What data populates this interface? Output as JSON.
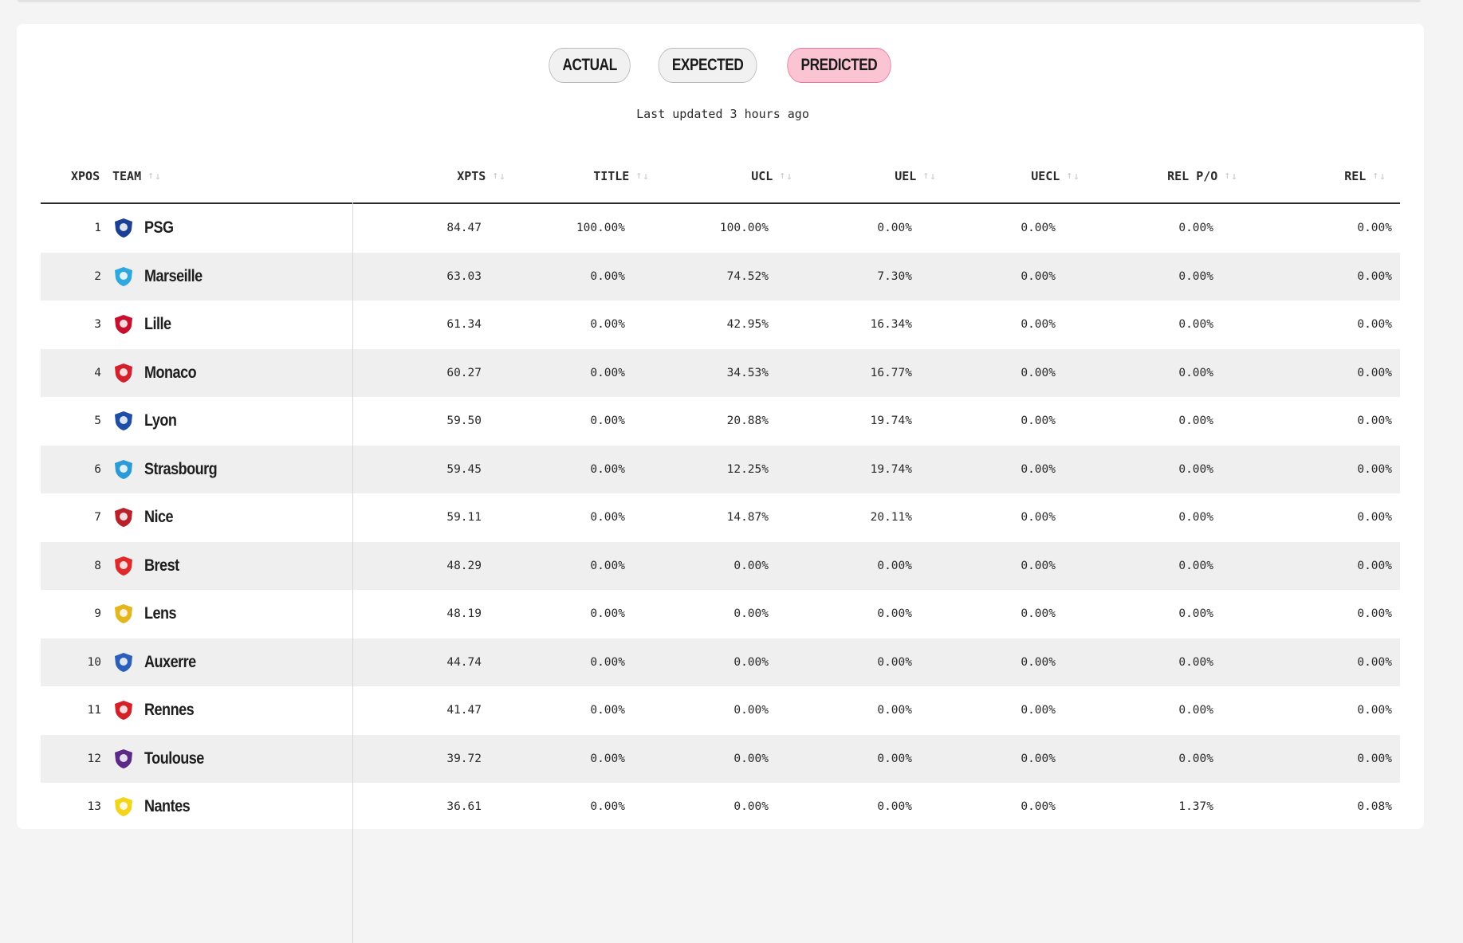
{
  "tabs": [
    {
      "label": "ACTUAL",
      "active": false
    },
    {
      "label": "EXPECTED",
      "active": false
    },
    {
      "label": "PREDICTED",
      "active": true
    }
  ],
  "last_updated": "Last updated 3 hours ago",
  "columns": {
    "xpos": "XPOS",
    "team": "TEAM",
    "xpts": "XPTS",
    "title": "TITLE",
    "ucl": "UCL",
    "uel": "UEL",
    "uecl": "UECL",
    "rel_po": "REL P/O",
    "rel": "REL"
  },
  "icons": {
    "sort": "sort-arrows-icon"
  },
  "colors": {
    "active_tab_bg": "#fbc4d3",
    "active_tab_border": "#e8789c",
    "row_alt_bg": "#efefef"
  },
  "rows": [
    {
      "xpos": "1",
      "team": "PSG",
      "crest": "psg-crest-icon",
      "crest_color": "#1c3f94",
      "xpts": "84.47",
      "title": "100.00%",
      "ucl": "100.00%",
      "uel": "0.00%",
      "uecl": "0.00%",
      "rel_po": "0.00%",
      "rel": "0.00%"
    },
    {
      "xpos": "2",
      "team": "Marseille",
      "crest": "marseille-crest-icon",
      "crest_color": "#2fa8df",
      "xpts": "63.03",
      "title": "0.00%",
      "ucl": "74.52%",
      "uel": "7.30%",
      "uecl": "0.00%",
      "rel_po": "0.00%",
      "rel": "0.00%"
    },
    {
      "xpos": "3",
      "team": "Lille",
      "crest": "lille-crest-icon",
      "crest_color": "#c8102e",
      "xpts": "61.34",
      "title": "0.00%",
      "ucl": "42.95%",
      "uel": "16.34%",
      "uecl": "0.00%",
      "rel_po": "0.00%",
      "rel": "0.00%"
    },
    {
      "xpos": "4",
      "team": "Monaco",
      "crest": "monaco-crest-icon",
      "crest_color": "#d4202c",
      "xpts": "60.27",
      "title": "0.00%",
      "ucl": "34.53%",
      "uel": "16.77%",
      "uecl": "0.00%",
      "rel_po": "0.00%",
      "rel": "0.00%"
    },
    {
      "xpos": "5",
      "team": "Lyon",
      "crest": "lyon-crest-icon",
      "crest_color": "#1e4ea8",
      "xpts": "59.50",
      "title": "0.00%",
      "ucl": "20.88%",
      "uel": "19.74%",
      "uecl": "0.00%",
      "rel_po": "0.00%",
      "rel": "0.00%"
    },
    {
      "xpos": "6",
      "team": "Strasbourg",
      "crest": "strasbourg-crest-icon",
      "crest_color": "#2a9bd6",
      "xpts": "59.45",
      "title": "0.00%",
      "ucl": "12.25%",
      "uel": "19.74%",
      "uecl": "0.00%",
      "rel_po": "0.00%",
      "rel": "0.00%"
    },
    {
      "xpos": "7",
      "team": "Nice",
      "crest": "nice-crest-icon",
      "crest_color": "#b8202a",
      "xpts": "59.11",
      "title": "0.00%",
      "ucl": "14.87%",
      "uel": "20.11%",
      "uecl": "0.00%",
      "rel_po": "0.00%",
      "rel": "0.00%"
    },
    {
      "xpos": "8",
      "team": "Brest",
      "crest": "brest-crest-icon",
      "crest_color": "#e02a2a",
      "xpts": "48.29",
      "title": "0.00%",
      "ucl": "0.00%",
      "uel": "0.00%",
      "uecl": "0.00%",
      "rel_po": "0.00%",
      "rel": "0.00%"
    },
    {
      "xpos": "9",
      "team": "Lens",
      "crest": "lens-crest-icon",
      "crest_color": "#e4b51c",
      "xpts": "48.19",
      "title": "0.00%",
      "ucl": "0.00%",
      "uel": "0.00%",
      "uecl": "0.00%",
      "rel_po": "0.00%",
      "rel": "0.00%"
    },
    {
      "xpos": "10",
      "team": "Auxerre",
      "crest": "auxerre-crest-icon",
      "crest_color": "#2c5fb8",
      "xpts": "44.74",
      "title": "0.00%",
      "ucl": "0.00%",
      "uel": "0.00%",
      "uecl": "0.00%",
      "rel_po": "0.00%",
      "rel": "0.00%"
    },
    {
      "xpos": "11",
      "team": "Rennes",
      "crest": "rennes-crest-icon",
      "crest_color": "#d42027",
      "xpts": "41.47",
      "title": "0.00%",
      "ucl": "0.00%",
      "uel": "0.00%",
      "uecl": "0.00%",
      "rel_po": "0.00%",
      "rel": "0.00%"
    },
    {
      "xpos": "12",
      "team": "Toulouse",
      "crest": "toulouse-crest-icon",
      "crest_color": "#5b2a86",
      "xpts": "39.72",
      "title": "0.00%",
      "ucl": "0.00%",
      "uel": "0.00%",
      "uecl": "0.00%",
      "rel_po": "0.00%",
      "rel": "0.00%"
    },
    {
      "xpos": "13",
      "team": "Nantes",
      "crest": "nantes-crest-icon",
      "crest_color": "#f2d51a",
      "xpts": "36.61",
      "title": "0.00%",
      "ucl": "0.00%",
      "uel": "0.00%",
      "uecl": "0.00%",
      "rel_po": "1.37%",
      "rel": "0.08%"
    }
  ]
}
